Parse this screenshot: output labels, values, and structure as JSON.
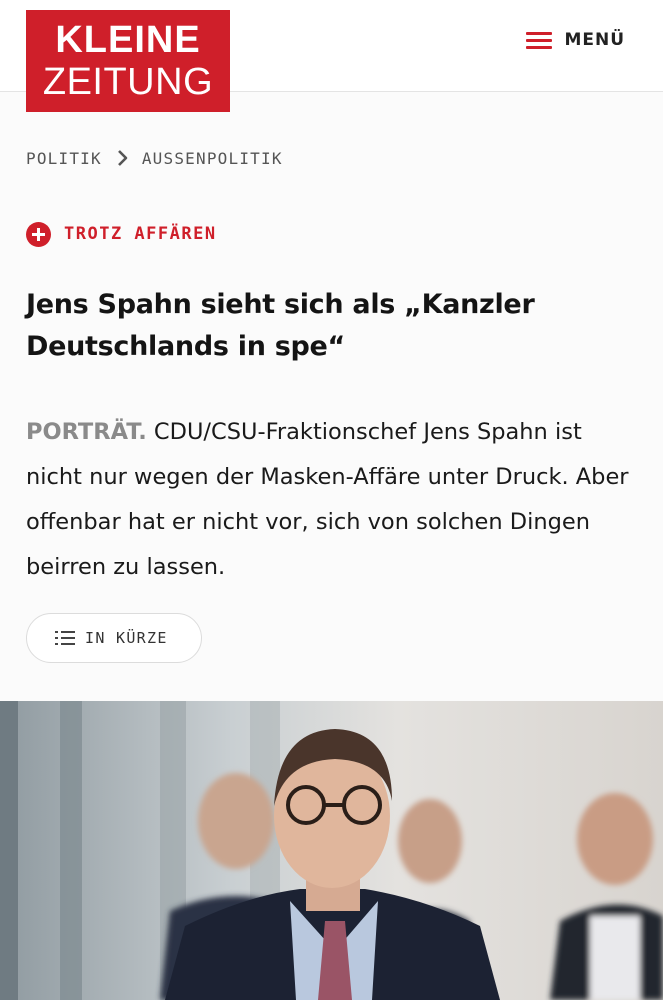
{
  "header": {
    "logo": {
      "line1": "KLEINE",
      "line2": "ZEITUNG"
    },
    "menu_label": "MENÜ"
  },
  "breadcrumb": {
    "items": [
      "POLITIK",
      "AUSSENPOLITIK"
    ]
  },
  "article": {
    "kicker": "TROTZ AFFÄREN",
    "headline": "Jens Spahn sieht sich als „Kanzler Deutschlands in spe“",
    "lead_tag": "PORTRÄT.",
    "lead_text": "CDU/CSU-Fraktionschef Jens Spahn ist nicht nur wegen der Masken-Affäre unter Druck. Aber offenbar hat er nicht vor, sich von solchen Dingen beirren zu lassen.",
    "summary_button": "IN KÜRZE"
  },
  "icons": {
    "menu": "hamburger-icon",
    "breadcrumb_separator": "chevron-right-icon",
    "kicker": "plus-circle-icon",
    "summary": "list-icon"
  },
  "colors": {
    "brand_red": "#cf1f2a",
    "text": "#141414",
    "lead_tag": "#8a8a8a"
  }
}
